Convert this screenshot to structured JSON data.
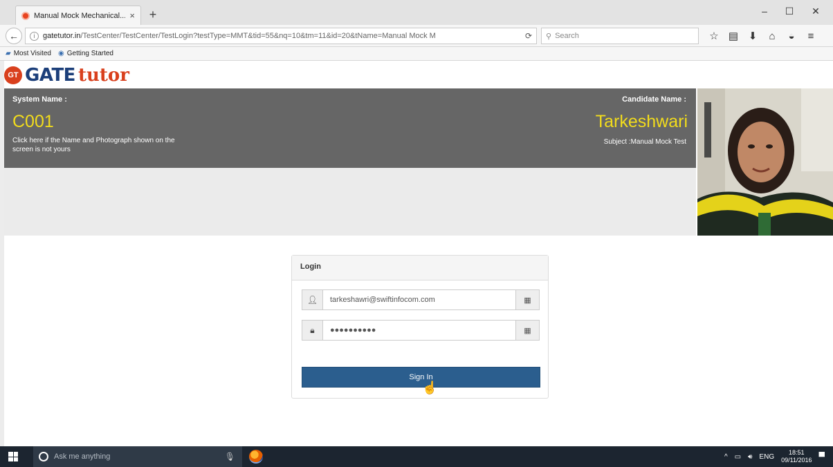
{
  "browser": {
    "tab_title": "Manual Mock Mechanical...",
    "tab_close": "×",
    "new_tab": "+",
    "window_controls": [
      "–",
      "☐",
      "✕"
    ],
    "url_host": "gatetutor.in",
    "url_path": "/TestCenter/TestCenter/TestLogin?testType=MMT&tid=55&nq=10&tm=11&id=20&tName=Manual Mock M",
    "search_placeholder": "Search",
    "bookmarks": [
      "Most Visited",
      "Getting Started"
    ]
  },
  "logo": {
    "badge": "GT",
    "gate": "GATE",
    "tutor": "tutor"
  },
  "header": {
    "system_label": "System Name :",
    "system_value": "C001",
    "system_note": "Click here if the Name and Photograph shown on the screen is not yours",
    "candidate_label": "Candidate Name :",
    "candidate_value": "Tarkeshwari",
    "subject": "Subject :Manual Mock Test"
  },
  "login": {
    "title": "Login",
    "username_value": "tarkeshawri@swiftinfocom.com",
    "password_value": "●●●●●●●●●●",
    "sign_in_label": "Sign In"
  },
  "taskbar": {
    "search_placeholder": "Ask me anything",
    "language": "ENG",
    "time": "18:51",
    "date": "09/11/2016"
  },
  "colors": {
    "header_band": "#666666",
    "highlight_yellow": "#f2dc1c",
    "button_blue": "#2b5e8e",
    "logo_blue": "#1c3f7a",
    "logo_orange": "#d9401d"
  }
}
